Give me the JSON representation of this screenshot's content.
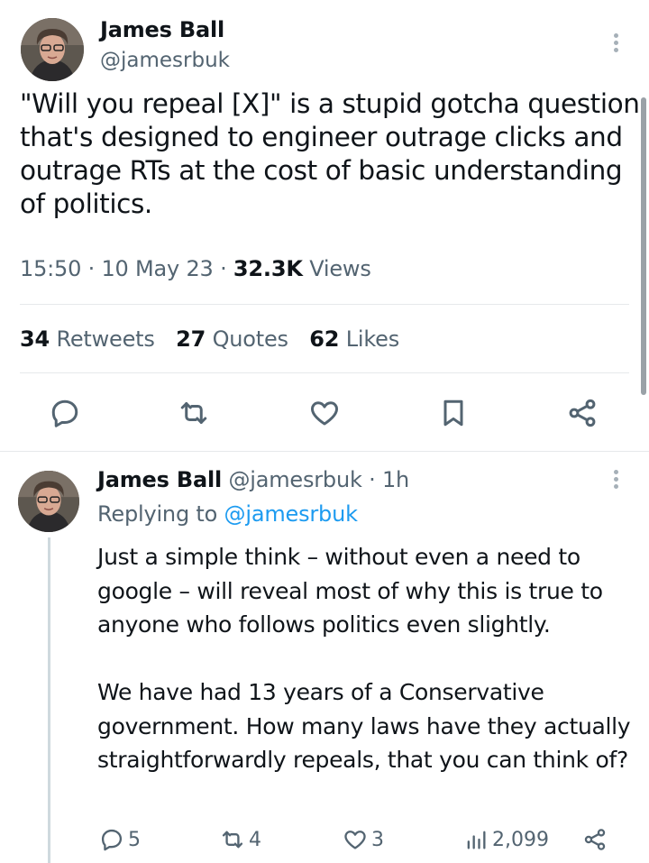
{
  "main_tweet": {
    "author_name": "James Ball",
    "author_handle": "@jamesrbuk",
    "text": "\"Will you repeal [X]\" is a stupid gotcha question that's designed to engineer outrage clicks and outrage RTs at the cost of basic understanding of politics.",
    "time": "15:50",
    "date": "10 May 23",
    "views_count": "32.3K",
    "views_label": "Views",
    "retweets_count": "34",
    "retweets_label": "Retweets",
    "quotes_count": "27",
    "quotes_label": "Quotes",
    "likes_count": "62",
    "likes_label": "Likes",
    "actions": [
      "reply-icon",
      "retweet-icon",
      "like-icon",
      "bookmark-icon",
      "share-icon"
    ]
  },
  "reply_tweet": {
    "author_name": "James Ball",
    "author_handle": "@jamesrbuk",
    "time": "1h",
    "replying_prefix": "Replying to",
    "replying_to": "@jamesrbuk",
    "paragraph1": "Just a simple think – without even a need to google – will reveal most of why this is true to anyone who follows politics even slightly.",
    "paragraph2": "We have had 13 years of a Conservative government. How many laws have they actually straightforwardly repeals, that you can think of?",
    "reply_count": "5",
    "retweet_count": "4",
    "like_count": "3",
    "views_count": "2,099"
  },
  "colors": {
    "text": "#0f1419",
    "secondary": "#536471",
    "link": "#1d9bf0",
    "divider": "#e6e9eb"
  }
}
